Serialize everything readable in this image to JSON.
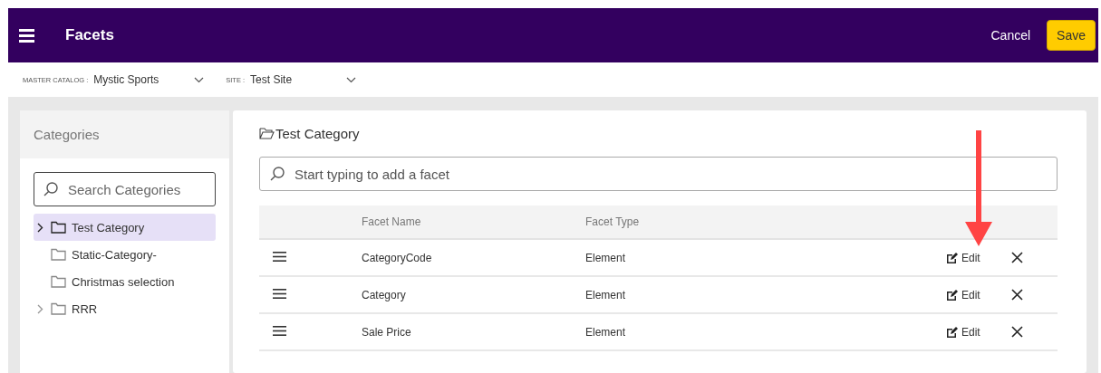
{
  "header": {
    "title": "Facets",
    "cancel": "Cancel",
    "save": "Save"
  },
  "filters": [
    {
      "label": "MASTER CATALOG :",
      "value": "Mystic Sports"
    },
    {
      "label": "SITE :",
      "value": "Test Site"
    }
  ],
  "sidebar": {
    "title": "Categories",
    "search": {
      "placeholder": "Search Categories"
    },
    "items": [
      {
        "label": "Test Category",
        "selected": true,
        "expandable": true
      },
      {
        "label": "Static-Category-",
        "selected": false,
        "expandable": false
      },
      {
        "label": "Christmas selection",
        "selected": false,
        "expandable": false
      },
      {
        "label": "RRR",
        "selected": false,
        "expandable": true
      }
    ]
  },
  "main": {
    "title": "Test Category",
    "search": {
      "placeholder": "Start typing to add a facet"
    },
    "table": {
      "columns": [
        "Facet Name",
        "Facet Type"
      ],
      "rows": [
        {
          "name": "CategoryCode",
          "type": "Element",
          "edit": "Edit"
        },
        {
          "name": "Category",
          "type": "Element",
          "edit": "Edit"
        },
        {
          "name": "Sale Price",
          "type": "Element",
          "edit": "Edit"
        }
      ]
    }
  }
}
